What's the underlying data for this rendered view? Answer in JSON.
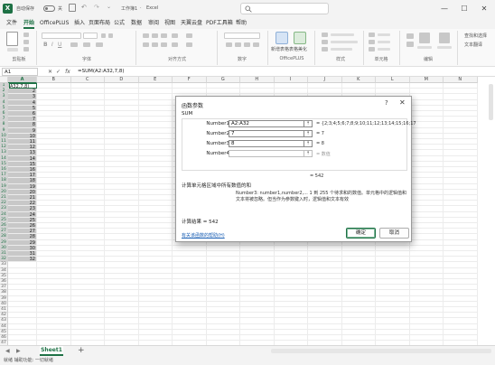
{
  "titlebar": {
    "autosave_label": "自动保存",
    "toggle_state": "关",
    "file_name": "工作簿1",
    "app_name": "Excel",
    "separator": "·",
    "search_placeholder": "",
    "minimize_glyph": "—",
    "maximize_glyph": "☐",
    "close_glyph": "✕"
  },
  "menu": {
    "items": [
      "文件",
      "开始",
      "OfficePLUS",
      "插入",
      "页面布局",
      "公式",
      "数据",
      "审阅",
      "视图",
      "天翼云盘",
      "PDF工具箱",
      "帮助"
    ],
    "active_index": 1
  },
  "ribbon": {
    "groups": [
      "剪贴板",
      "字体",
      "对齐方式",
      "数字",
      "OfficePLUS",
      "样式",
      "单元格",
      "编辑"
    ],
    "officeplus_buttons": [
      "新增表格",
      "表格美化"
    ],
    "find_select_label": "查找和选择",
    "text_label": "文本翻译"
  },
  "formula_bar": {
    "name_box": "A1",
    "cancel_glyph": "✕",
    "enter_glyph": "✓",
    "fx_label": "fx",
    "formula": "=SUM(A2:A32,7,8)"
  },
  "grid": {
    "columns": [
      "A",
      "B",
      "C",
      "D",
      "E",
      "F",
      "G",
      "H",
      "I",
      "J",
      "K",
      "L",
      "M",
      "N"
    ],
    "selected_column": "A",
    "row_count": 49,
    "a1_text": "A32,7,8)",
    "a_values": [
      "2",
      "3",
      "4",
      "5",
      "6",
      "7",
      "8",
      "9",
      "10",
      "11",
      "12",
      "13",
      "14",
      "15",
      "16",
      "17",
      "18",
      "19",
      "20",
      "21",
      "22",
      "23",
      "24",
      "25",
      "26",
      "27",
      "28",
      "29",
      "30",
      "31",
      "32"
    ]
  },
  "sheet_tabs": {
    "tabs": [
      "Sheet1"
    ],
    "add_glyph": "+",
    "prev_glyph": "◀",
    "next_glyph": "▶"
  },
  "status_bar": {
    "text": "就绪  辅助功能: 一切就绪"
  },
  "dialog": {
    "title": "函数参数",
    "help_glyph": "?",
    "close_glyph": "✕",
    "function_name": "SUM",
    "args": [
      {
        "label": "Number1",
        "value": "A2:A32",
        "preview": "= {2;3;4;5;6;7;8;9;10;11;12;13;14;15;16;17",
        "dim": false
      },
      {
        "label": "Number2",
        "value": "7",
        "preview": "= 7",
        "dim": false
      },
      {
        "label": "Number3",
        "value": "8",
        "preview": "= 8",
        "dim": false
      },
      {
        "label": "Number4",
        "value": "",
        "preview": "= 数值",
        "dim": true
      }
    ],
    "collapse_glyph": "⇡",
    "function_result": "= 542",
    "description": "计算单元格区域中所有数值的和",
    "arg_description": "Number3:  number1,number2,... 1 到 255 个待求和的数值。单元格中的逻辑值和文本将被忽略。但当作为参数键入时，逻辑值和文本有效",
    "calc_result": "计算结果 =   542",
    "help_link": "有关该函数的帮助(H)",
    "ok_label": "确定",
    "cancel_label": "取消"
  },
  "colors": {
    "accent": "#1e7145",
    "selection": "#c8c8c8",
    "link": "#1a5fb4"
  }
}
